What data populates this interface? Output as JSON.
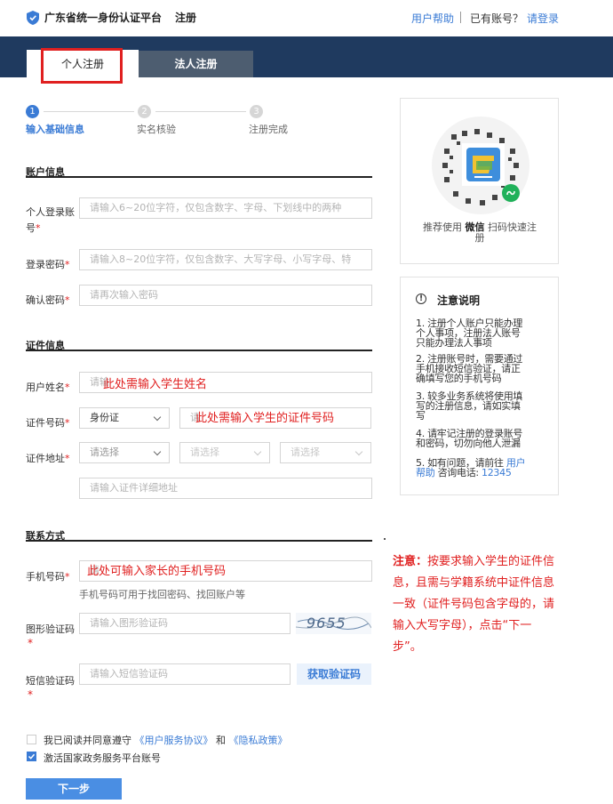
{
  "header": {
    "title": "广东省统一身份认证平台",
    "subtitle": "注册",
    "help": "用户帮助",
    "have_account": "已有账号？",
    "login": "请登录"
  },
  "tabs": {
    "personal": "个人注册",
    "legal": "法人注册"
  },
  "steps": [
    {
      "num": "1",
      "label": "输入基础信息"
    },
    {
      "num": "2",
      "label": "实名核验"
    },
    {
      "num": "3",
      "label": "注册完成"
    }
  ],
  "account": {
    "title": "账户信息",
    "username_label_1": "个人登录账",
    "username_label_2": "号",
    "username_ph": "请输入6~20位字符，仅包含数字、字母、下划线中的两种",
    "password_label": "登录密码",
    "password_ph": "请输入8~20位字符，仅包含数字、大写字母、小写字母、特",
    "confirm_label": "确认密码",
    "confirm_ph": "请再次输入密码"
  },
  "cert": {
    "title": "证件信息",
    "name_label": "用户姓名",
    "name_ph": "请输",
    "name_note": "此处需输入学生姓名",
    "id_label": "证件号码",
    "id_type": "身份证",
    "id_ph": "请",
    "id_note": "此处需输入学生的证件号码",
    "addr_label": "证件地址",
    "addr_sel1": "请选择",
    "addr_sel2": "请选择",
    "addr_sel3": "请选择",
    "addr_detail_ph": "请输入证件详细地址"
  },
  "contact": {
    "title": "联系方式",
    "phone_label": "手机号码",
    "phone_ph": "请",
    "phone_note": "此处可输入家长的手机号码",
    "phone_hint": "手机号码可用于找回密码、找回账户等",
    "captcha_label": "图形验证码",
    "captcha_ph": "请输入图形验证码",
    "captcha_text": "9655",
    "sms_label": "短信验证码",
    "sms_ph": "请输入短信验证码",
    "sms_btn": "获取验证码"
  },
  "agreements": {
    "read_text": "我已阅读并同意遵守",
    "service": "《用户服务协议》",
    "and": "和",
    "privacy": "《隐私政策》",
    "activate": "激活国家政务服务平台账号"
  },
  "next_btn": "下一步",
  "sidebar": {
    "qr_caption_1": "推荐使用",
    "qr_caption_bold": "微信",
    "qr_caption_2": "扫码快速注",
    "qr_caption_3": "册",
    "notice_title": "注意说明",
    "notices": [
      [
        "1. 注册个人账户只能办理",
        "个人事项，注册法人账号",
        "只能办理法人事项"
      ],
      [
        "2. 注册账号时，需要通过",
        "手机接收短信验证，请正",
        "确填写您的手机号码"
      ],
      [
        "3. 较多业务系统将使用填",
        "写的注册信息，请如实填",
        "写"
      ],
      [
        "4. 请牢记注册的登录账号",
        "和密码，切勿向他人泄漏"
      ]
    ],
    "notice5_a": "5. 如有问题，请前往",
    "notice5_link1": "用户",
    "notice5_link2": "帮助",
    "notice5_b": "咨询电话:",
    "notice5_phone": "12345"
  },
  "annotation": {
    "title": "注意：",
    "body": "按要求输入学生的证件信息，且需与学籍系统中证件信息一致（证件号码包含字母的，请输入大写字母），点击“下一步”。"
  },
  "colors": {
    "navy": "#1f3a5f",
    "accent": "#3a7bd5",
    "red": "#e02020"
  }
}
